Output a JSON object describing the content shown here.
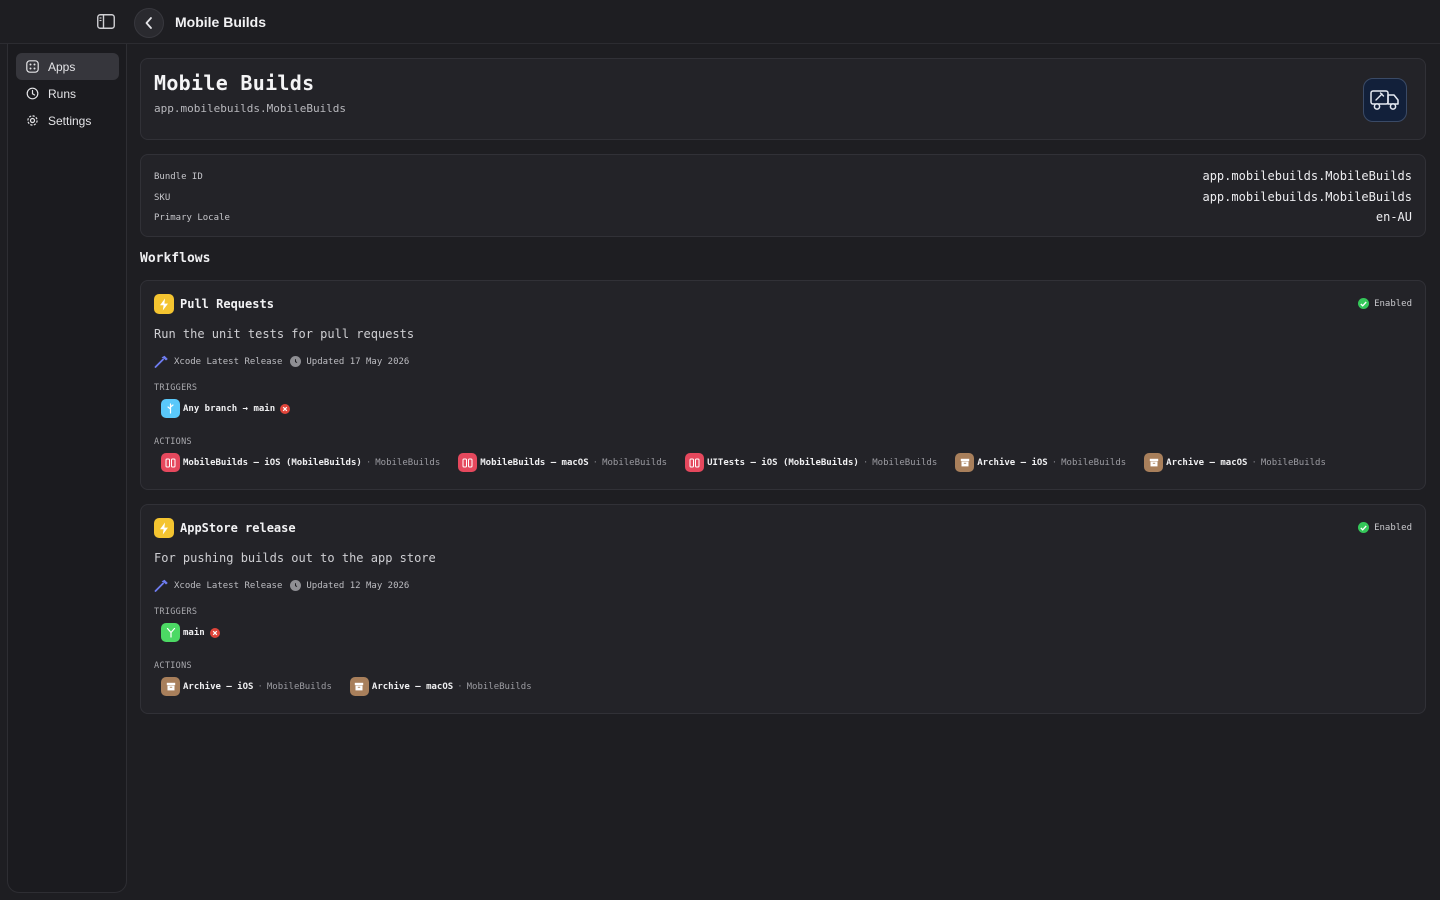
{
  "topbar": {
    "title": "Mobile Builds"
  },
  "sidebar": {
    "items": [
      {
        "label": "Apps",
        "icon": "apps-icon",
        "active": true
      },
      {
        "label": "Runs",
        "icon": "history-icon",
        "active": false
      },
      {
        "label": "Settings",
        "icon": "gear-icon",
        "active": false
      }
    ]
  },
  "app": {
    "name": "Mobile Builds",
    "bundle": "app.mobilebuilds.MobileBuilds",
    "icon": "delivery-truck-icon"
  },
  "info": {
    "rows": [
      {
        "label": "Bundle ID",
        "value": "app.mobilebuilds.MobileBuilds"
      },
      {
        "label": "SKU",
        "value": "app.mobilebuilds.MobileBuilds"
      },
      {
        "label": "Primary Locale",
        "value": "en-AU"
      }
    ]
  },
  "workflows_title": "Workflows",
  "workflows": [
    {
      "name": "Pull Requests",
      "status": "Enabled",
      "description": "Run the unit tests for pull requests",
      "xcode": "Xcode Latest Release",
      "updated": "Updated 17 May 2026",
      "triggers_label": "TRIGGERS",
      "trigger": {
        "text": "Any branch → main",
        "icon": "branch-icon",
        "color": "#5ac8fa"
      },
      "actions_label": "ACTIONS",
      "actions": [
        {
          "name": "MobileBuilds – iOS (MobileBuilds)",
          "project": "MobileBuilds",
          "kind": "test"
        },
        {
          "name": "MobileBuilds – macOS",
          "project": "MobileBuilds",
          "kind": "test"
        },
        {
          "name": "UITests – iOS (MobileBuilds)",
          "project": "MobileBuilds",
          "kind": "test"
        },
        {
          "name": "Archive – iOS",
          "project": "MobileBuilds",
          "kind": "archive"
        },
        {
          "name": "Archive – macOS",
          "project": "MobileBuilds",
          "kind": "archive"
        }
      ]
    },
    {
      "name": "AppStore release",
      "status": "Enabled",
      "description": "For pushing builds out to the app store",
      "xcode": "Xcode Latest Release",
      "updated": "Updated 12 May 2026",
      "triggers_label": "TRIGGERS",
      "trigger": {
        "text": "main",
        "icon": "merge-icon",
        "color": "#4cd964"
      },
      "actions_label": "ACTIONS",
      "actions": [
        {
          "name": "Archive – iOS",
          "project": "MobileBuilds",
          "kind": "archive"
        },
        {
          "name": "Archive – macOS",
          "project": "MobileBuilds",
          "kind": "archive"
        }
      ]
    }
  ],
  "colors": {
    "background": "#1e1e22",
    "card": "#232328",
    "enabled": "#34c759",
    "bolt": "#f4c430",
    "test_action": "#e5485d",
    "archive_action": "#a87f5b",
    "remove": "#e0453a"
  }
}
